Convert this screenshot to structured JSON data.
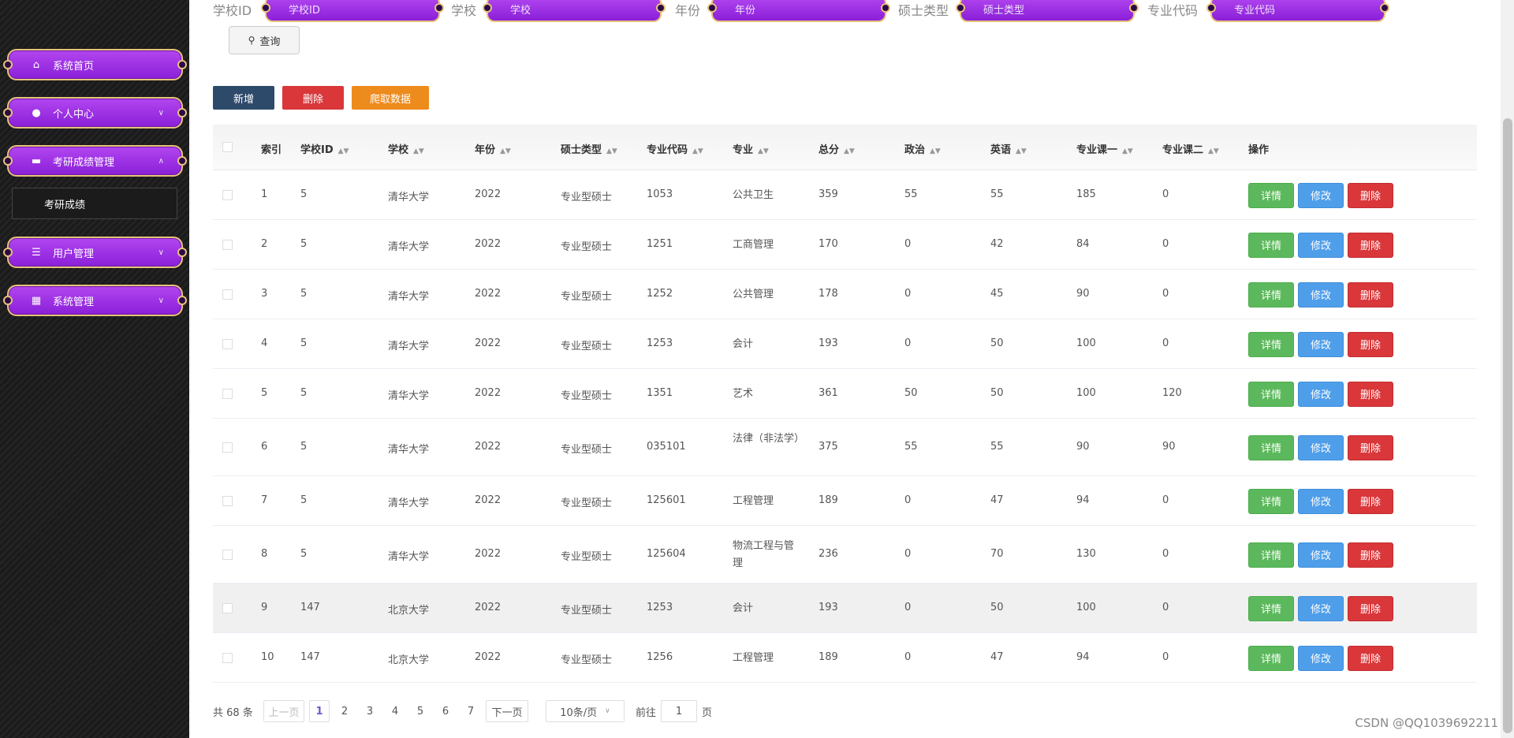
{
  "sidebar": {
    "items": [
      {
        "label": "系统首页",
        "icon": "home-icon"
      },
      {
        "label": "个人中心",
        "icon": "user-icon"
      },
      {
        "label": "考研成绩管理",
        "icon": "briefcase-icon"
      },
      {
        "label": "用户管理",
        "icon": "list-icon"
      },
      {
        "label": "系统管理",
        "icon": "grid-icon"
      }
    ],
    "sub_item": "考研成绩"
  },
  "filters": [
    {
      "label": "学校ID",
      "placeholder": "学校ID"
    },
    {
      "label": "学校",
      "placeholder": "学校"
    },
    {
      "label": "年份",
      "placeholder": "年份"
    },
    {
      "label": "硕士类型",
      "placeholder": "硕士类型"
    },
    {
      "label": "专业代码",
      "placeholder": "专业代码"
    }
  ],
  "query_label": "查询",
  "actions": {
    "add": "新增",
    "delete": "删除",
    "crawl": "爬取数据"
  },
  "table": {
    "headers": [
      "索引",
      "学校ID",
      "学校",
      "年份",
      "硕士类型",
      "专业代码",
      "专业",
      "总分",
      "政治",
      "英语",
      "专业课一",
      "专业课二",
      "操作"
    ],
    "op_labels": {
      "detail": "详情",
      "edit": "修改",
      "delete": "删除"
    },
    "rows": [
      [
        "1",
        "5",
        "清华大学",
        "2022",
        "专业型硕士",
        "1053",
        "公共卫生",
        "359",
        "55",
        "55",
        "185",
        "0"
      ],
      [
        "2",
        "5",
        "清华大学",
        "2022",
        "专业型硕士",
        "1251",
        "工商管理",
        "170",
        "0",
        "42",
        "84",
        "0"
      ],
      [
        "3",
        "5",
        "清华大学",
        "2022",
        "专业型硕士",
        "1252",
        "公共管理",
        "178",
        "0",
        "45",
        "90",
        "0"
      ],
      [
        "4",
        "5",
        "清华大学",
        "2022",
        "专业型硕士",
        "1253",
        "会计",
        "193",
        "0",
        "50",
        "100",
        "0"
      ],
      [
        "5",
        "5",
        "清华大学",
        "2022",
        "专业型硕士",
        "1351",
        "艺术",
        "361",
        "50",
        "50",
        "100",
        "120"
      ],
      [
        "6",
        "5",
        "清华大学",
        "2022",
        "专业型硕士",
        "035101",
        "法律（非法学）",
        "375",
        "55",
        "55",
        "90",
        "90"
      ],
      [
        "7",
        "5",
        "清华大学",
        "2022",
        "专业型硕士",
        "125601",
        "工程管理",
        "189",
        "0",
        "47",
        "94",
        "0"
      ],
      [
        "8",
        "5",
        "清华大学",
        "2022",
        "专业型硕士",
        "125604",
        "物流工程与管理",
        "236",
        "0",
        "70",
        "130",
        "0"
      ],
      [
        "9",
        "147",
        "北京大学",
        "2022",
        "专业型硕士",
        "1253",
        "会计",
        "193",
        "0",
        "50",
        "100",
        "0"
      ],
      [
        "10",
        "147",
        "北京大学",
        "2022",
        "专业型硕士",
        "1256",
        "工程管理",
        "189",
        "0",
        "47",
        "94",
        "0"
      ]
    ]
  },
  "pagination": {
    "total": "共 68 条",
    "prev": "上一页",
    "pages": [
      "1",
      "2",
      "3",
      "4",
      "5",
      "6",
      "7"
    ],
    "next": "下一页",
    "page_size": "10条/页",
    "goto_label": "前往",
    "goto_value": "1",
    "goto_suffix": "页"
  },
  "watermark": "CSDN @QQ1039692211",
  "colors": {
    "menu": "#9b30e6",
    "menu_border": "#e8c27a",
    "add_btn": "#2e4a6b",
    "delete_btn": "#d9373a",
    "crawl_btn": "#ee8b1d"
  }
}
